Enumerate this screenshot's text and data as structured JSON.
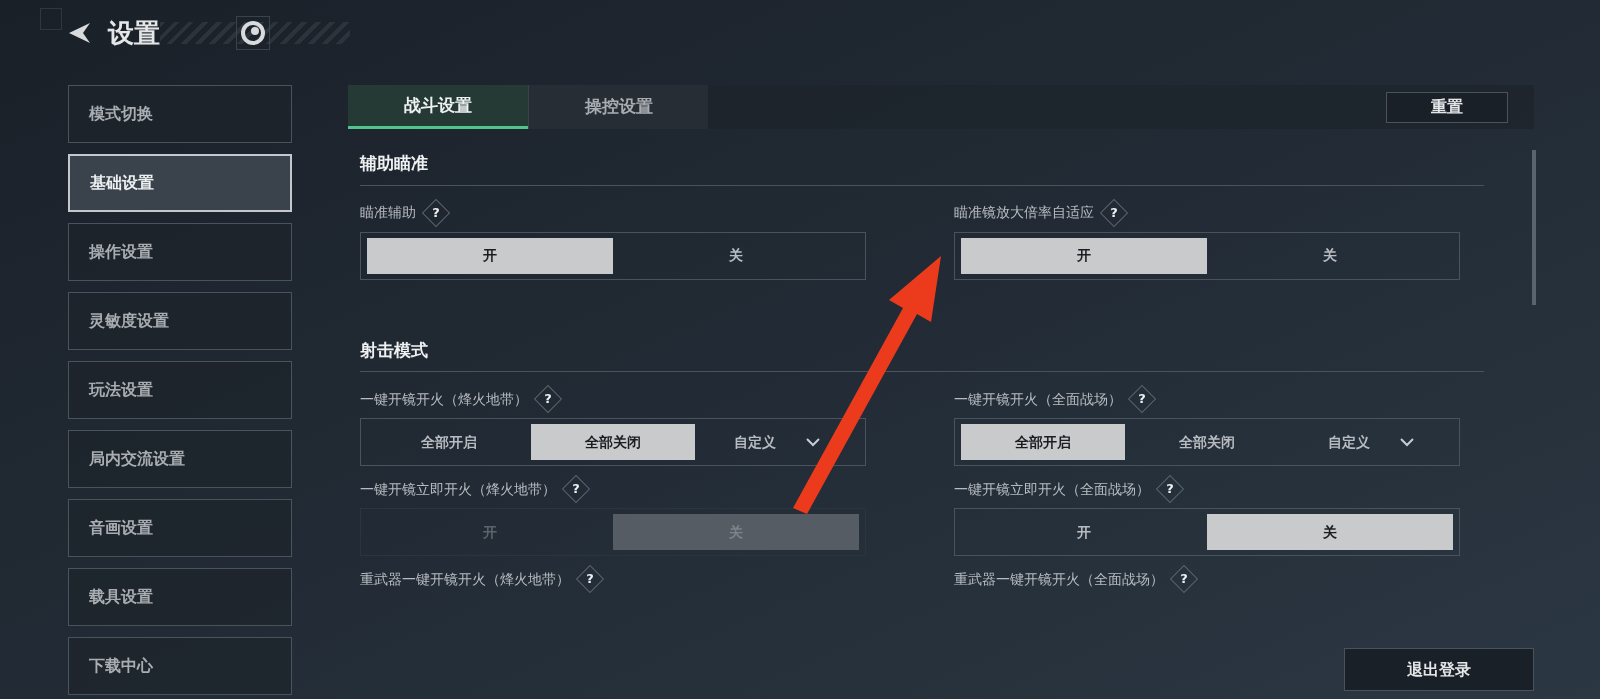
{
  "header": {
    "title": "设置"
  },
  "sidebar": {
    "items": [
      {
        "label": "模式切换",
        "selected": false
      },
      {
        "label": "基础设置",
        "selected": true
      },
      {
        "label": "操作设置",
        "selected": false
      },
      {
        "label": "灵敏度设置",
        "selected": false
      },
      {
        "label": "玩法设置",
        "selected": false
      },
      {
        "label": "局内交流设置",
        "selected": false
      },
      {
        "label": "音画设置",
        "selected": false
      },
      {
        "label": "载具设置",
        "selected": false
      },
      {
        "label": "下载中心",
        "selected": false
      }
    ]
  },
  "tabs": [
    {
      "label": "战斗设置",
      "selected": true
    },
    {
      "label": "操控设置",
      "selected": false
    }
  ],
  "reset_button": "重置",
  "sections": [
    {
      "title": "辅助瞄准",
      "settings": [
        {
          "label": "瞄准辅助",
          "help": "?",
          "kind": "toggle",
          "disabled": false,
          "options": [
            {
              "label": "开",
              "selected": true
            },
            {
              "label": "关",
              "selected": false
            }
          ]
        },
        {
          "label": "瞄准镜放大倍率自适应",
          "help": "?",
          "kind": "toggle",
          "disabled": false,
          "options": [
            {
              "label": "开",
              "selected": true
            },
            {
              "label": "关",
              "selected": false
            }
          ]
        }
      ]
    },
    {
      "title": "射击模式",
      "settings": [
        {
          "label": "一键开镜开火（烽火地带）",
          "help": "?",
          "kind": "segmented",
          "disabled": false,
          "options": [
            {
              "label": "全部开启",
              "selected": false
            },
            {
              "label": "全部关闭",
              "selected": true
            },
            {
              "label": "自定义",
              "selected": false,
              "dropdown": true
            }
          ]
        },
        {
          "label": "一键开镜开火（全面战场）",
          "help": "?",
          "kind": "segmented",
          "disabled": false,
          "options": [
            {
              "label": "全部开启",
              "selected": true
            },
            {
              "label": "全部关闭",
              "selected": false
            },
            {
              "label": "自定义",
              "selected": false,
              "dropdown": true
            }
          ]
        },
        {
          "label": "一键开镜立即开火（烽火地带）",
          "help": "?",
          "kind": "toggle",
          "disabled": true,
          "options": [
            {
              "label": "开",
              "selected": false
            },
            {
              "label": "关",
              "selected": true
            }
          ]
        },
        {
          "label": "一键开镜立即开火（全面战场）",
          "help": "?",
          "kind": "toggle",
          "disabled": false,
          "options": [
            {
              "label": "开",
              "selected": false
            },
            {
              "label": "关",
              "selected": true
            }
          ]
        },
        {
          "label": "重武器一键开镜开火（烽火地带）",
          "help": "?",
          "kind": "label"
        },
        {
          "label": "重武器一键开镜开火（全面战场）",
          "help": "?",
          "kind": "label"
        }
      ]
    }
  ],
  "logout_button": "退出登录"
}
